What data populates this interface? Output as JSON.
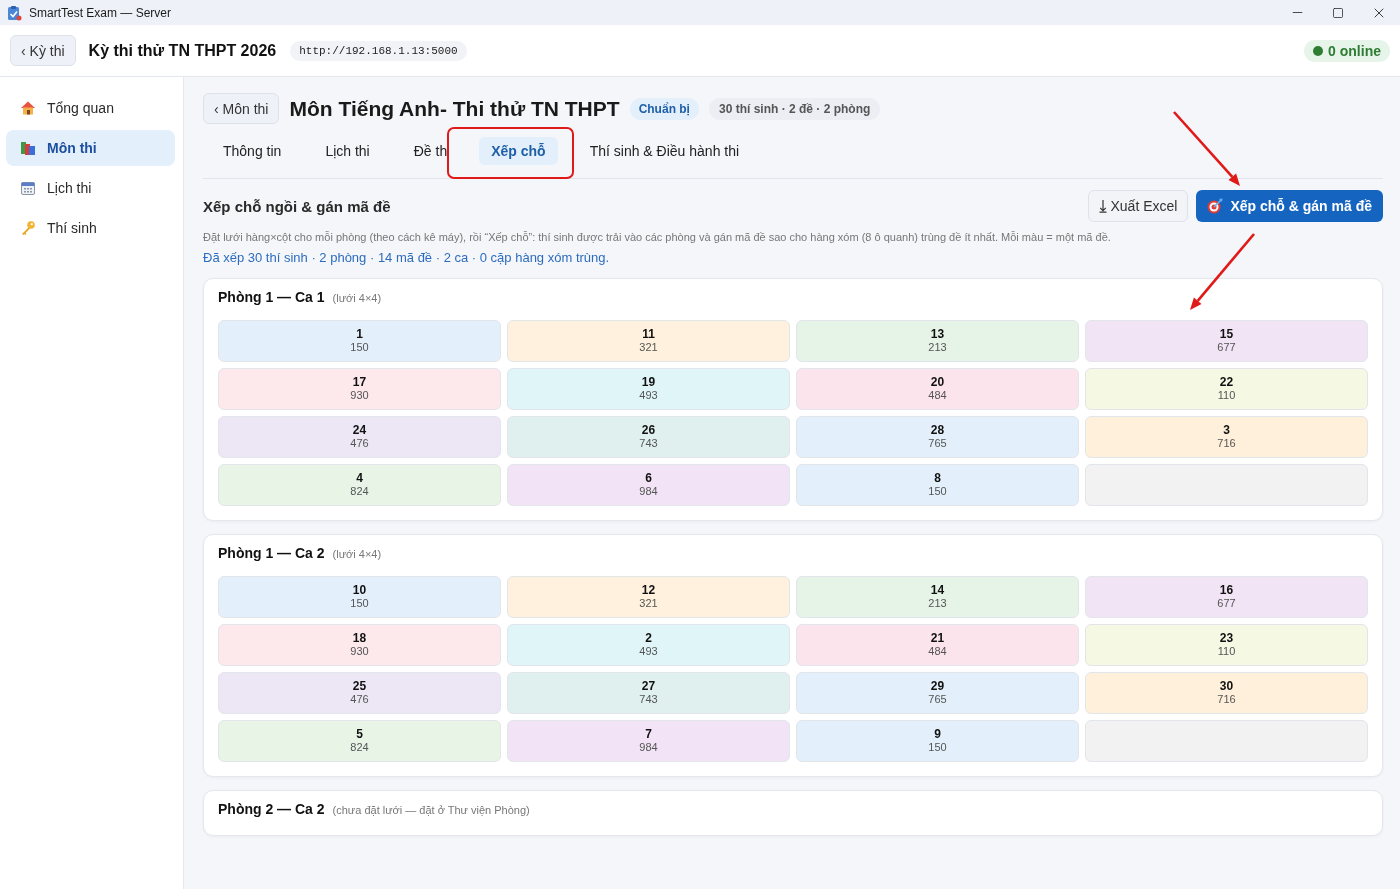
{
  "window": {
    "title": "SmartTest Exam — Server"
  },
  "header": {
    "back_button": "‹ Kỳ thi",
    "title": "Kỳ thi thử TN THPT 2026",
    "server_url": "http://192.168.1.13:5000",
    "online_status": "0 online"
  },
  "sidebar": {
    "items": [
      {
        "label": "Tổng quan",
        "selected": false
      },
      {
        "label": "Môn thi",
        "selected": true
      },
      {
        "label": "Lịch thi",
        "selected": false
      },
      {
        "label": "Thí sinh",
        "selected": false
      }
    ]
  },
  "subject": {
    "back_button": "‹ Môn thi",
    "title": "Môn Tiếng Anh- Thi thử TN THPT",
    "status": "Chuẩn bị",
    "summary": "30 thí sinh · 2 đề · 2 phòng"
  },
  "tabs": [
    {
      "label": "Thông tin",
      "selected": false
    },
    {
      "label": "Lịch thi",
      "selected": false
    },
    {
      "label": "Đề th",
      "selected": false
    },
    {
      "label": "Xếp chỗ",
      "selected": true
    },
    {
      "label": "Thí sinh & Điều hành thi",
      "selected": false
    }
  ],
  "seating": {
    "title": "Xếp chỗ ngồi & gán mã đề",
    "export_button": "Xuất Excel",
    "arrange_button": "Xếp chỗ & gán mã đề",
    "description": "Đặt lưới hàng×cột cho mỗi phòng (theo cách kê máy), rồi “Xếp chỗ”: thí sinh được trải vào các phòng và gán mã đề sao cho hàng xóm (8 ô quanh) trùng đề ít nhất. Mỗi màu = một mã đề.",
    "result": "Đã xếp 30 thí sinh · 2 phòng · 14 mã đề · 2 ca · 0 cặp hàng xóm trùng.",
    "rooms": [
      {
        "title": "Phòng 1 — Ca 1",
        "note": "(lưới 4×4)",
        "cells": [
          {
            "kind": "seat",
            "number": "1",
            "code": "150",
            "color": "#e3f0fc"
          },
          {
            "kind": "seat",
            "number": "11",
            "code": "321",
            "color": "#fff1de"
          },
          {
            "kind": "seat",
            "number": "13",
            "code": "213",
            "color": "#e6f4e8"
          },
          {
            "kind": "seat",
            "number": "15",
            "code": "677",
            "color": "#f1e4f5"
          },
          {
            "kind": "seat",
            "number": "17",
            "code": "930",
            "color": "#fde8ec"
          },
          {
            "kind": "seat",
            "number": "19",
            "code": "493",
            "color": "#dff5f8"
          },
          {
            "kind": "seat",
            "number": "20",
            "code": "484",
            "color": "#fce4ec"
          },
          {
            "kind": "seat",
            "number": "22",
            "code": "110",
            "color": "#f5f8e3"
          },
          {
            "kind": "seat",
            "number": "24",
            "code": "476",
            "color": "#ede6f4"
          },
          {
            "kind": "seat",
            "number": "26",
            "code": "743",
            "color": "#e0f0ef"
          },
          {
            "kind": "seat",
            "number": "28",
            "code": "765",
            "color": "#e3effb"
          },
          {
            "kind": "seat",
            "number": "3",
            "code": "716",
            "color": "#fff0dc"
          },
          {
            "kind": "seat",
            "number": "4",
            "code": "824",
            "color": "#e7f4e6"
          },
          {
            "kind": "seat",
            "number": "6",
            "code": "984",
            "color": "#f2e3f6"
          },
          {
            "kind": "seat",
            "number": "8",
            "code": "150",
            "color": "#e3f0fc"
          },
          {
            "kind": "empty"
          }
        ]
      },
      {
        "title": "Phòng 1 — Ca 2",
        "note": "(lưới 4×4)",
        "cells": [
          {
            "kind": "seat",
            "number": "10",
            "code": "150",
            "color": "#e3f0fc"
          },
          {
            "kind": "seat",
            "number": "12",
            "code": "321",
            "color": "#fff1de"
          },
          {
            "kind": "seat",
            "number": "14",
            "code": "213",
            "color": "#e6f4e8"
          },
          {
            "kind": "seat",
            "number": "16",
            "code": "677",
            "color": "#f1e4f5"
          },
          {
            "kind": "seat",
            "number": "18",
            "code": "930",
            "color": "#fde8ec"
          },
          {
            "kind": "seat",
            "number": "2",
            "code": "493",
            "color": "#dff5f8"
          },
          {
            "kind": "seat",
            "number": "21",
            "code": "484",
            "color": "#fce4ec"
          },
          {
            "kind": "seat",
            "number": "23",
            "code": "110",
            "color": "#f5f8e3"
          },
          {
            "kind": "seat",
            "number": "25",
            "code": "476",
            "color": "#ede6f4"
          },
          {
            "kind": "seat",
            "number": "27",
            "code": "743",
            "color": "#e0f0ef"
          },
          {
            "kind": "seat",
            "number": "29",
            "code": "765",
            "color": "#e3effb"
          },
          {
            "kind": "seat",
            "number": "30",
            "code": "716",
            "color": "#fff0dc"
          },
          {
            "kind": "seat",
            "number": "5",
            "code": "824",
            "color": "#e7f4e6"
          },
          {
            "kind": "seat",
            "number": "7",
            "code": "984",
            "color": "#f2e3f6"
          },
          {
            "kind": "seat",
            "number": "9",
            "code": "150",
            "color": "#e3f0fc"
          },
          {
            "kind": "empty"
          }
        ]
      },
      {
        "title": "Phòng 2 — Ca 2",
        "note": "(chưa đặt lưới — đặt ở Thư viện Phòng)"
      }
    ]
  }
}
